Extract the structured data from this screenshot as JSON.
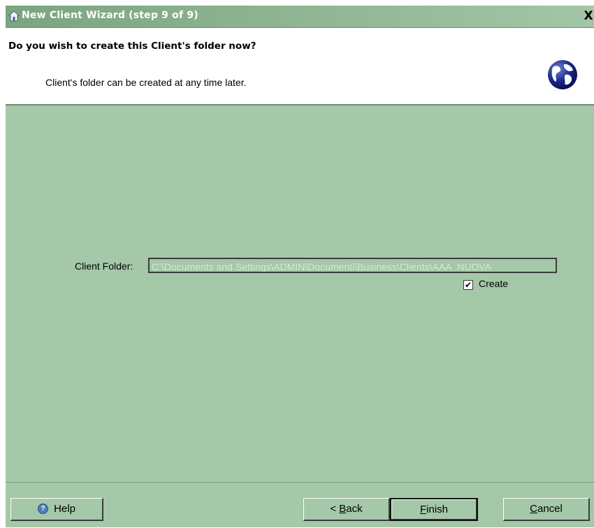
{
  "window": {
    "title": "New Client Wizard  (step 9 of 9)",
    "close_glyph": "X"
  },
  "header": {
    "question": "Do you wish to create this Client's folder now?",
    "subtitle": "Client's folder can be created at any time later.",
    "icon": "globe-icon"
  },
  "form": {
    "folder_label": "Client Folder:",
    "folder_value": "C:\\Documents and Settings\\ADMIN\\Documenti\\Business\\Clients\\AAA_NUOVA",
    "create_checked": true,
    "create_label": "Create"
  },
  "buttons": {
    "help": "Help",
    "back_prefix": "< ",
    "back_mnemonic": "B",
    "back_rest": "ack",
    "finish_mnemonic": "F",
    "finish_rest": "inish",
    "cancel_mnemonic": "C",
    "cancel_rest": "ancel"
  },
  "colors": {
    "panel": "#a4c8a8",
    "title_text": "#ffffff"
  }
}
